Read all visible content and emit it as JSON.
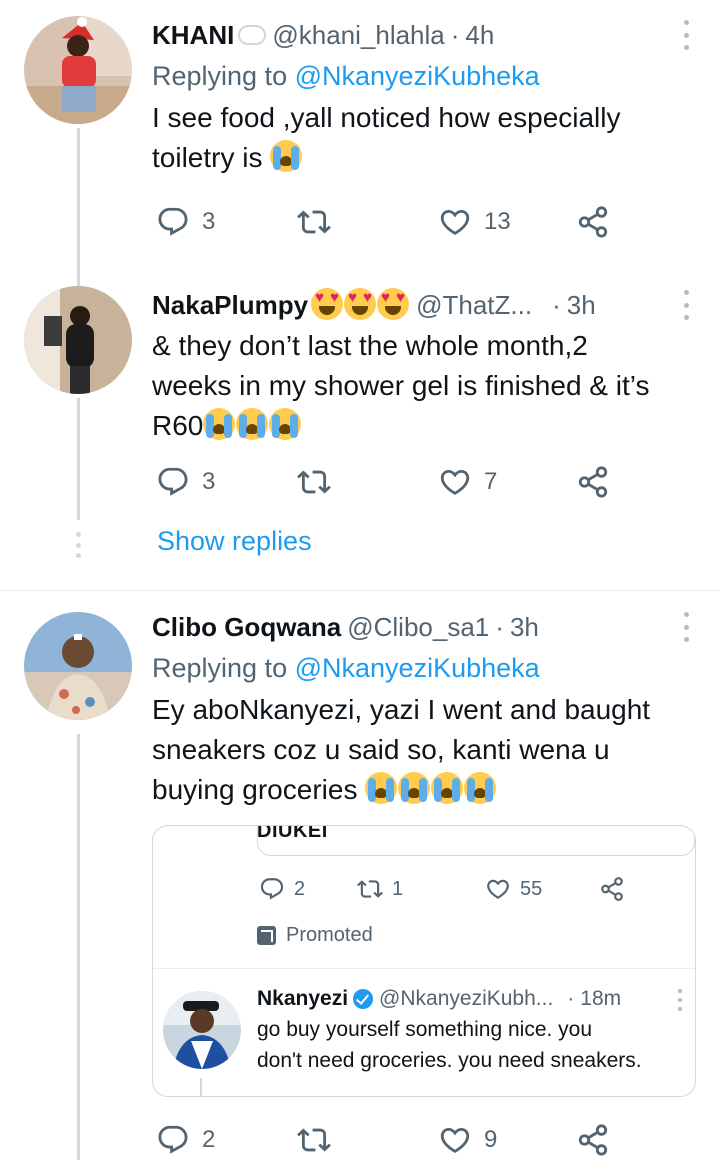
{
  "tweets": [
    {
      "name": "KHANI",
      "name_emoji": "speech-balloon",
      "handle": "@khani_hlahla",
      "time": "4h",
      "replying_prefix": "Replying to",
      "replying_to": "@NkanyeziKubheka",
      "text_line1": "I see food ,yall noticed how especially",
      "text_line2": "toiletry is",
      "text_emoji": "crying-face",
      "replies": "3",
      "retweets": "",
      "likes": "13"
    },
    {
      "name": "NakaPlumpy",
      "name_emoji": "heart-eyes-x3",
      "handle": "@ThatZ...",
      "time": "3h",
      "text_line1": "& they don’t last the whole month,2",
      "text_line2": "weeks in my shower gel is finished & it’s",
      "text_line3": "R60",
      "text_emoji": "crying-face-x3",
      "replies": "3",
      "retweets": "",
      "likes": "7"
    },
    {
      "name": "Clibo Goqwana",
      "handle": "@Clibo_sa1",
      "time": "3h",
      "replying_prefix": "Replying to",
      "replying_to": "@NkanyeziKubheka",
      "text_line1": "Ey aboNkanyezi, yazi I went and baught",
      "text_line2": "sneakers coz u said so, kanti wena u",
      "text_line3": "buying groceries",
      "text_emoji": "crying-face-x4",
      "replies": "2",
      "retweets": "",
      "likes": "9"
    }
  ],
  "show_replies": "Show replies",
  "quoted": {
    "inner_text": "DIUKEI",
    "replies": "2",
    "retweets": "1",
    "likes": "55",
    "promoted": "Promoted",
    "name": "Nkanyezi",
    "handle": "@NkanyeziKubh...",
    "time": "18m",
    "text_line1": "go buy yourself something nice. you",
    "text_line2": "don't need groceries. you need sneakers."
  },
  "dot": "·",
  "colors": {
    "link": "#1d9bf0",
    "text": "#0f1419",
    "muted": "#536471",
    "border": "#cfd9de"
  }
}
